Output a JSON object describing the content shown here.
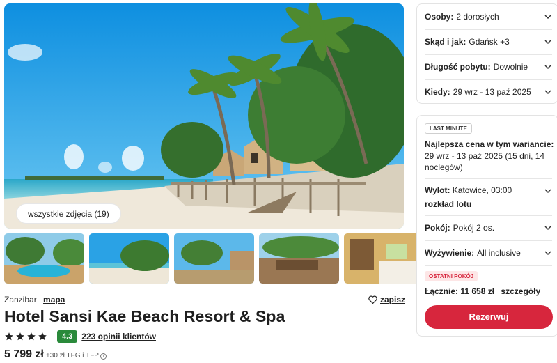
{
  "gallery": {
    "all_photos_label": "wszystkie zdjęcia (19)",
    "thumbnails": [
      "pool-thumbnail",
      "beach-thumbnail",
      "garden-thumbnail",
      "terrace-thumbnail",
      "room-thumbnail"
    ]
  },
  "hotel": {
    "region": "Zanzibar",
    "map_link": "mapa",
    "save_label": "zapisz",
    "name": "Hotel Sansi Kae Beach Resort & Spa",
    "stars": 4,
    "score": "4.3",
    "reviews_label": "223 opinii klientów",
    "price": "5 799 zł",
    "price_extra": "+30 zł TFG i TFP",
    "info_icon": "i"
  },
  "options": [
    {
      "key": "Osoby:",
      "value": "2 dorosłych"
    },
    {
      "key": "Skąd i jak:",
      "value": "Gdańsk +3"
    },
    {
      "key": "Długość pobytu:",
      "value": "Dowolnie"
    },
    {
      "key": "Kiedy:",
      "value": "29 wrz - 13 paź 2025"
    }
  ],
  "offer": {
    "badge": "LAST MINUTE",
    "best_title": "Najlepsza cena w tym wariancie:",
    "best_dates": "29 wrz - 13 paź 2025 (15 dni, 14 noclegów)",
    "flight_key": "Wylot:",
    "flight_value": "Katowice, 03:00",
    "flight_link": "rozkład lotu",
    "room_key": "Pokój:",
    "room_value": "Pokój 2 os.",
    "board_key": "Wyżywienie:",
    "board_value": "All inclusive",
    "last_room_badge": "OSTATNI POKÓJ",
    "total_key": "Łącznie:",
    "total_value": "11 658 zł",
    "details_link": "szczegóły",
    "book_label": "Rezerwuj"
  },
  "colors": {
    "accent": "#d7263d",
    "score_bg": "#2a8a3b",
    "sky": "#1aa3e8",
    "sand": "#efe8da"
  }
}
